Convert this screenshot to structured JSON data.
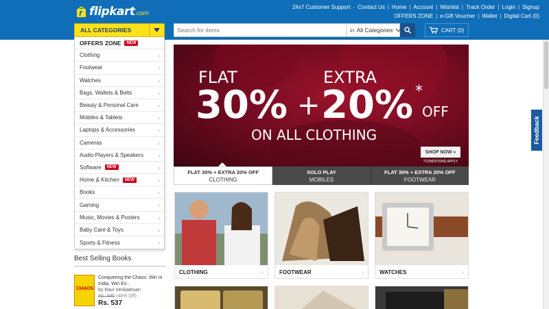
{
  "brand": {
    "logo_text": "flipkart",
    "logo_suffix": ".com",
    "color": "#0f6eb7",
    "accent": "#ffe11b"
  },
  "header": {
    "top_links": [
      "24x7 Customer Support",
      "Contact Us",
      "Home",
      "Account",
      "Wishlist",
      "Track Order",
      "Login",
      "Signup"
    ],
    "second_links": [
      "OFFERS ZONE",
      "e-Gift Voucher",
      "Wallet",
      "Digital Cart (0)"
    ],
    "all_categories_label": "ALL CATEGORIES",
    "search_placeholder": "Search for items",
    "search_in_prefix": "in",
    "search_category": "All Categories",
    "cart_label": "CART (0)"
  },
  "menu": {
    "items": [
      {
        "label": "OFFERS ZONE",
        "new": true,
        "badge": "NEW"
      },
      {
        "label": "Clothing"
      },
      {
        "label": "Footwear"
      },
      {
        "label": "Watches"
      },
      {
        "label": "Bags, Wallets & Belts"
      },
      {
        "label": "Beauty & Personal Care"
      },
      {
        "label": "Mobiles & Tablets"
      },
      {
        "label": "Laptops & Accessories"
      },
      {
        "label": "Cameras"
      },
      {
        "label": "Audio Players & Speakers"
      },
      {
        "label": "Software",
        "badge": "NEW"
      },
      {
        "label": "Home & Kitchen",
        "badge": "NEW"
      },
      {
        "label": "Books"
      },
      {
        "label": "Gaming"
      },
      {
        "label": "Music, Movies & Posters"
      },
      {
        "label": "Baby Care & Toys"
      },
      {
        "label": "Sports & Fitness"
      }
    ]
  },
  "best_selling": {
    "title": "Best Selling Books",
    "book": {
      "cover_text": "CHAOS",
      "title": "Conquering the Chaos: Win in India, Win Ev...",
      "author": "by Ravi Venkatesan",
      "old_price": "Rs. 595",
      "discount": "(40% Off)",
      "price": "Rs. 537"
    }
  },
  "banner": {
    "flat": "FLAT",
    "extra": "EXTRA",
    "pct1": "30%",
    "plus": "+",
    "pct2": "20%",
    "star": "*",
    "off": "OFF",
    "sub": "ON ALL CLOTHING",
    "shop_now": "SHOP NOW »",
    "conditions": "*CONDITIONS APPLY"
  },
  "tabs": [
    {
      "line1": "FLAT 30% + EXTRA 20% OFF",
      "line2": "CLOTHING",
      "active": true
    },
    {
      "line1": "XOLO PLAY",
      "line2": "MOBILES",
      "active": false
    },
    {
      "line1": "FLAT 30% + EXTRA 20% OFF",
      "line2": "FOOTWEAR",
      "active": false
    }
  ],
  "tiles": [
    {
      "label": "CLOTHING"
    },
    {
      "label": "FOOTWEAR"
    },
    {
      "label": "WATCHES"
    }
  ],
  "feedback_label": "Feedback"
}
